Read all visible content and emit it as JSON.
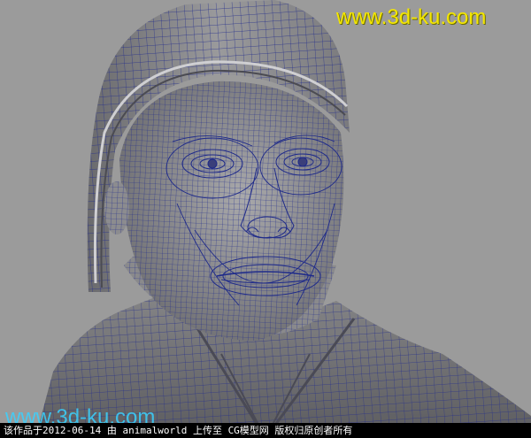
{
  "viewport": {
    "background_color": "#9b9b9b",
    "mesh_color": "#8e8e90",
    "wire_color": "#232d8c"
  },
  "watermark": {
    "top_text": "www.3d-ku.com",
    "top_color": "#f3e600",
    "bottom_text": "www.3d-ku.com",
    "bottom_color": "#3ad2ff"
  },
  "caption": {
    "text": "该作品于2012-06-14 由 animalworld 上传至 CG模型网  版权归原创者所有"
  }
}
